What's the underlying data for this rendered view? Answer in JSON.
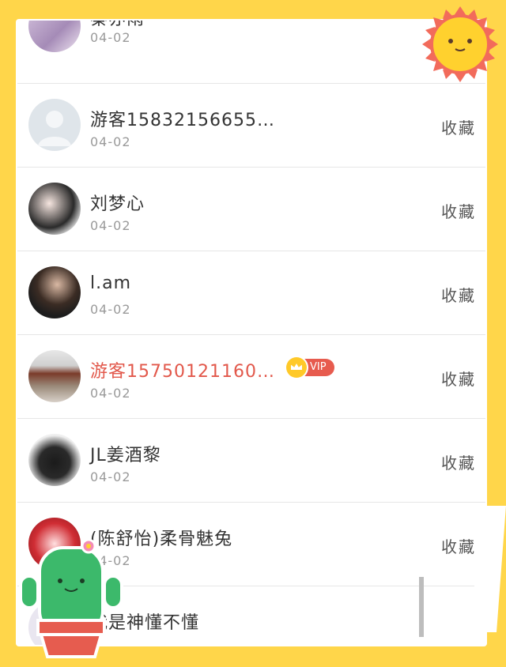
{
  "list": {
    "items": [
      {
        "name": "秦亦雨",
        "date": "04-02",
        "fav": "",
        "vip": false
      },
      {
        "name": "游客15832156655…",
        "date": "04-02",
        "fav": "收藏",
        "vip": false
      },
      {
        "name": "刘梦心",
        "date": "04-02",
        "fav": "收藏",
        "vip": false
      },
      {
        "name": "l.am",
        "date": "04-02",
        "fav": "收藏",
        "vip": false
      },
      {
        "name": "游客15750121160…",
        "date": "04-02",
        "fav": "收藏",
        "vip": true,
        "vip_label": "VIP"
      },
      {
        "name": "JL姜酒黎",
        "date": "04-02",
        "fav": "收藏",
        "vip": false
      },
      {
        "name": "(陈舒怡)柔骨魅兔",
        "date": "04-02",
        "fav": "收藏",
        "vip": false
      },
      {
        "name": "我是神懂不懂",
        "date": "",
        "fav": "",
        "vip": false
      }
    ]
  },
  "colors": {
    "background": "#FFD64A",
    "vip_name": "#e2584b",
    "vip_badge": "#e75b4e"
  },
  "icons": [
    "sun-sticker-icon",
    "cactus-sticker-icon",
    "crown-icon"
  ]
}
